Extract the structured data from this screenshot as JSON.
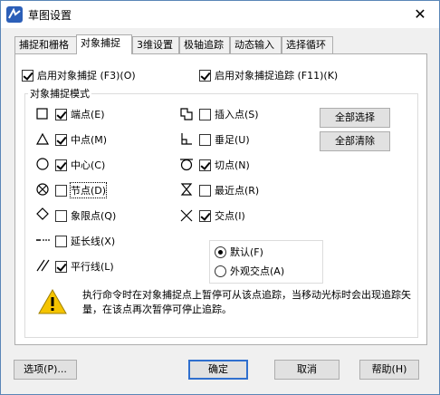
{
  "window": {
    "title": "草图设置",
    "close_glyph": "✕"
  },
  "tabs": [
    {
      "label": "捕捉和栅格"
    },
    {
      "label": "对象捕捉"
    },
    {
      "label": "3维设置"
    },
    {
      "label": "极轴追踪"
    },
    {
      "label": "动态输入"
    },
    {
      "label": "选择循环"
    }
  ],
  "options": {
    "enable_snap": {
      "label": "启用对象捕捉 (F3)(O)",
      "checked": true
    },
    "enable_tracking": {
      "label": "启用对象捕捉追踪 (F11)(K)",
      "checked": true
    }
  },
  "snap_modes": {
    "group_label": "对象捕捉模式",
    "left": [
      {
        "label": "端点(E)",
        "checked": true,
        "icon": "endpoint-square-icon"
      },
      {
        "label": "中点(M)",
        "checked": true,
        "icon": "midpoint-triangle-icon"
      },
      {
        "label": "中心(C)",
        "checked": true,
        "icon": "center-circle-icon"
      },
      {
        "label": "节点(D)",
        "checked": false,
        "icon": "node-x-circle-icon"
      },
      {
        "label": "象限点(Q)",
        "checked": false,
        "icon": "quadrant-diamond-icon"
      },
      {
        "label": "延长线(X)",
        "checked": false,
        "icon": "extension-dashline-icon"
      },
      {
        "label": "平行线(L)",
        "checked": true,
        "icon": "parallel-lines-icon"
      }
    ],
    "right": [
      {
        "label": "插入点(S)",
        "checked": false,
        "icon": "insertion-icon"
      },
      {
        "label": "垂足(U)",
        "checked": false,
        "icon": "perpendicular-icon"
      },
      {
        "label": "切点(N)",
        "checked": true,
        "icon": "tangent-icon"
      },
      {
        "label": "最近点(R)",
        "checked": false,
        "icon": "nearest-hourglass-icon"
      },
      {
        "label": "交点(I)",
        "checked": true,
        "icon": "intersection-x-icon"
      }
    ],
    "select_all": "全部选择",
    "clear_all": "全部清除"
  },
  "intersection_mode": {
    "default": {
      "label": "默认(F)",
      "selected": true
    },
    "apparent": {
      "label": "外观交点(A)",
      "selected": false
    }
  },
  "hint": "执行命令时在对象捕捉点上暂停可从该点追踪，当移动光标时会出现追踪矢量，在该点再次暂停可停止追踪。",
  "buttons": {
    "options": "选项(P)...",
    "ok": "确定",
    "cancel": "取消",
    "help": "帮助(H)"
  },
  "colors": {
    "accent": "#2f6fce",
    "warning": "#f5c400"
  }
}
